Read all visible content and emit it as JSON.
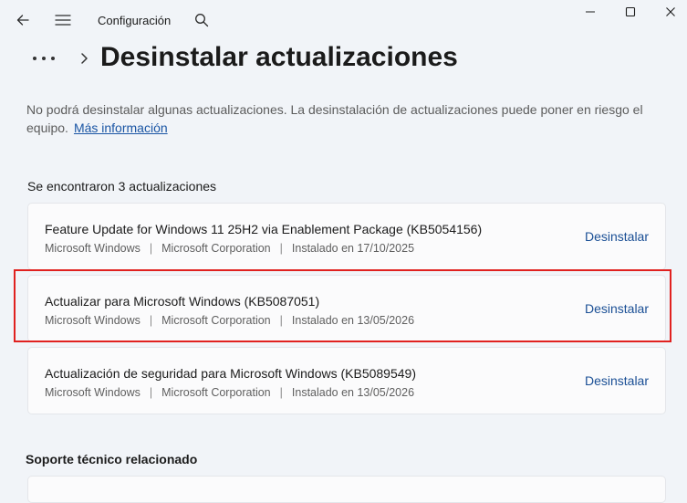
{
  "app": {
    "title": "Configuración"
  },
  "icons": {
    "back": "arrow-left-icon",
    "menu": "hamburger-icon",
    "search": "search-icon",
    "more": "ellipsis-icon",
    "chevron": "chevron-right-icon"
  },
  "page": {
    "title": "Desinstalar actualizaciones",
    "description": "No podrá desinstalar algunas actualizaciones. La desinstalación de actualizaciones puede poner en riesgo el equipo.",
    "more_info_link": "Más información",
    "found_label": "Se encontraron 3 actualizaciones"
  },
  "updates": [
    {
      "name": "Feature Update for Windows 11 25H2 via Enablement Package (KB5054156)",
      "product": "Microsoft Windows",
      "publisher": "Microsoft Corporation",
      "installed": "Instalado en 17/10/2025",
      "action": "Desinstalar"
    },
    {
      "name": "Actualizar para Microsoft Windows (KB5087051)",
      "product": "Microsoft Windows",
      "publisher": "Microsoft Corporation",
      "installed": "Instalado en 13/05/2026",
      "action": "Desinstalar"
    },
    {
      "name": "Actualización de seguridad para Microsoft Windows (KB5089549)",
      "product": "Microsoft Windows",
      "publisher": "Microsoft Corporation",
      "installed": "Instalado en 13/05/2026",
      "action": "Desinstalar"
    }
  ],
  "meta_separator": "|",
  "related": {
    "title": "Soporte técnico relacionado"
  },
  "colors": {
    "highlight": "#e0211f",
    "link": "#1a55a4",
    "background": "#f1f4f8"
  }
}
